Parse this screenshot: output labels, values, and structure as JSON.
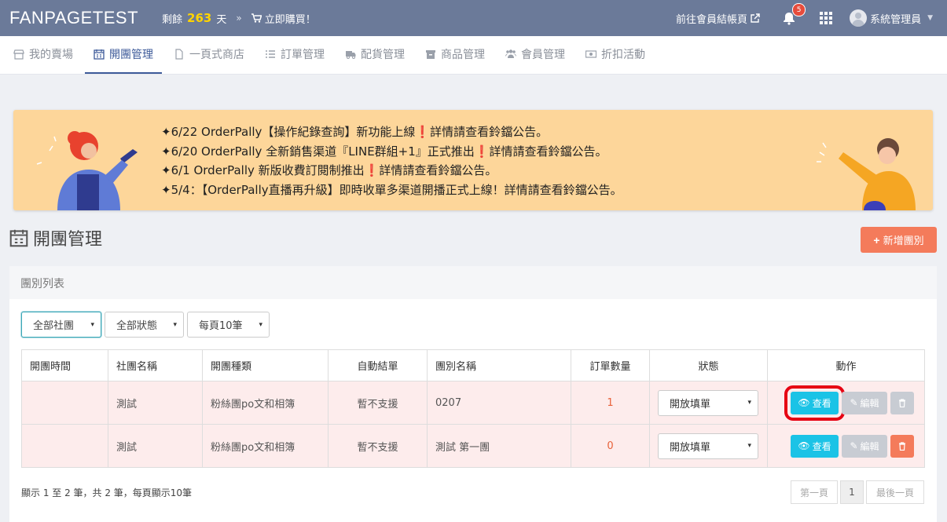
{
  "topbar": {
    "brand": "FANPAGETEST",
    "remain_prefix": "剩餘",
    "remain_days": "263",
    "remain_suffix": "天",
    "separator": "»",
    "buy_label": "立即購買！",
    "checkout_label": "前往會員結帳頁",
    "notification_count": "5",
    "user_name": "系統管理員"
  },
  "nav": {
    "items": [
      {
        "label": "我的賣場",
        "icon": "store-icon"
      },
      {
        "label": "開團管理",
        "icon": "calendar-icon",
        "active": true
      },
      {
        "label": "一頁式商店",
        "icon": "file-icon"
      },
      {
        "label": "訂單管理",
        "icon": "list-icon"
      },
      {
        "label": "配貨管理",
        "icon": "truck-icon"
      },
      {
        "label": "商品管理",
        "icon": "archive-icon"
      },
      {
        "label": "會員管理",
        "icon": "users-icon"
      },
      {
        "label": "折扣活動",
        "icon": "money-icon"
      }
    ]
  },
  "banner": {
    "lines": [
      "✦6/22 OrderPally【操作紀錄查詢】新功能上線❗詳情請查看鈴鐺公告。",
      "✦6/20 OrderPally 全新銷售渠道『LINE群組+1』正式推出❗詳情請查看鈴鐺公告。",
      "✦6/1 OrderPally 新版收費訂閱制推出❗詳情請查看鈴鐺公告。",
      "✦5/4：【OrderPally直播再升級】即時收單多渠道開播正式上線！詳情請查看鈴鐺公告。"
    ]
  },
  "page": {
    "title": "開團管理",
    "add_button": "新增團別"
  },
  "card": {
    "title": "團別列表",
    "filters": [
      "全部社團",
      "全部狀態",
      "每頁10筆"
    ],
    "columns": [
      "開團時間",
      "社團名稱",
      "開團種類",
      "自動結單",
      "團別名稱",
      "訂單數量",
      "狀態",
      "動作"
    ],
    "rows": [
      {
        "time": "",
        "group": "測試",
        "type": "粉絲團po文和相簿",
        "auto_close": "暫不支援",
        "name": "0207",
        "orders": "1",
        "status": "開放填單"
      },
      {
        "time": "",
        "group": "測試",
        "type": "粉絲團po文和相簿",
        "auto_close": "暫不支援",
        "name": "測試 第一團",
        "orders": "0",
        "status": "開放填單"
      }
    ],
    "view_label": "查看",
    "edit_label": "編輯",
    "summary": "顯示 1 至 2 筆，共 2 筆，每頁顯示10筆",
    "pager": {
      "first": "第一頁",
      "current": "1",
      "last": "最後一頁"
    }
  },
  "colors": {
    "topbar": "#6b7a99",
    "accent": "#3d5a99",
    "view_button": "#1bc3e6",
    "add_button": "#f47b5b",
    "highlight": "#e60012"
  }
}
